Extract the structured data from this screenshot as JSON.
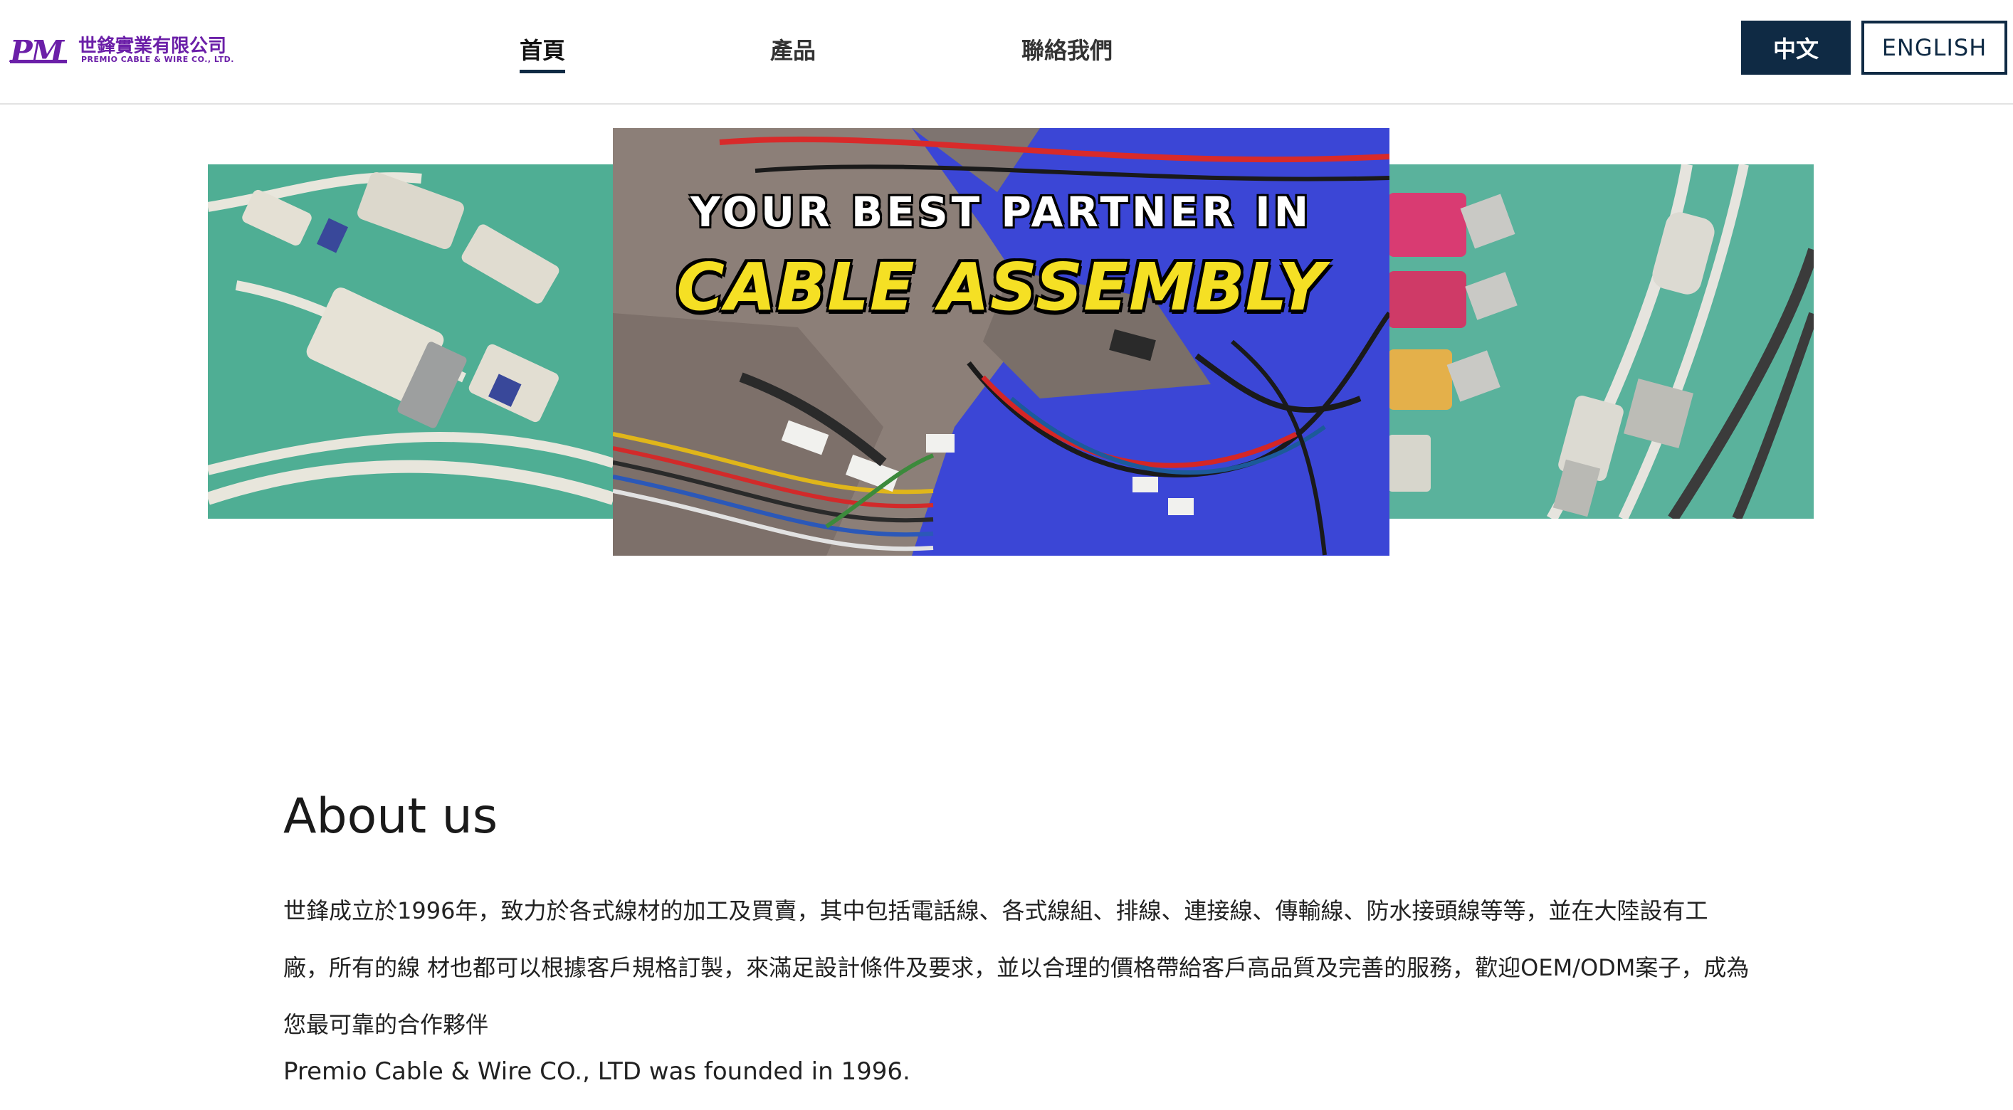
{
  "header": {
    "logo": {
      "mark": "PM",
      "name_cn": "世鋒實業有限公司",
      "name_en": "PREMIO CABLE & WIRE CO., LTD."
    },
    "nav": {
      "home": "首頁",
      "products": "產品",
      "contact": "聯絡我們"
    },
    "lang": {
      "zh": "中文",
      "en": "ENGLISH"
    }
  },
  "hero": {
    "line1": "YOUR BEST PARTNER IN",
    "line2": "CABLE ASSEMBLY"
  },
  "about": {
    "title": "About us",
    "paragraph_cn": "世鋒成立於1996年，致力於各式線材的加工及買賣，其中包括電話線、各式線組、排線、連接線、傳輸線、防水接頭線等等，並在大陸設有工廠，所有的線 材也都可以根據客戶規格訂製，來滿足設計條件及要求，並以合理的價格帶給客戶高品質及完善的服務，歡迎OEM/ODM案子，成為您最可靠的合作夥伴",
    "paragraph_en": "Premio Cable & Wire CO., LTD was founded in 1996."
  },
  "colors": {
    "brand_purple": "#6b1fa8",
    "navy": "#0f2a44",
    "hero_blue": "#3a44d8",
    "hero_yellow": "#f5e024",
    "hero_green": "#57b39a"
  }
}
